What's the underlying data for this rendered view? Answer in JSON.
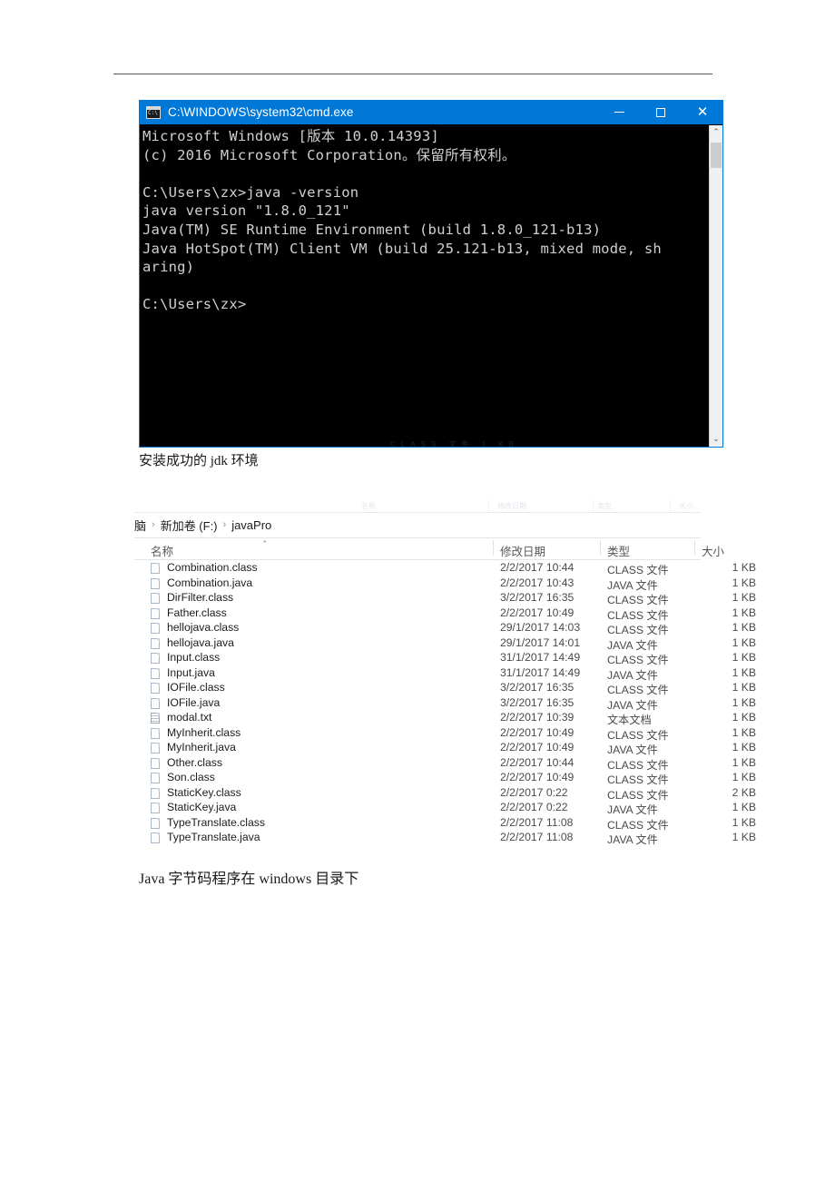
{
  "document": {
    "caption_1": "安装成功的 jdk 环境",
    "caption_2": "Java 字节码程序在 windows 目录下",
    "ghost_artifact": "CLASS 文件     1 KB"
  },
  "cmd_window": {
    "title": "C:\\WINDOWS\\system32\\cmd.exe",
    "icon": "cmd-icon",
    "buttons": {
      "minimize": "minimize",
      "maximize": "maximize",
      "close": "close"
    },
    "console_text": "Microsoft Windows [版本 10.0.14393]\n(c) 2016 Microsoft Corporation。保留所有权利。\n\nC:\\Users\\zx>java -version\njava version \"1.8.0_121\"\nJava(TM) SE Runtime Environment (build 1.8.0_121-b13)\nJava HotSpot(TM) Client VM (build 25.121-b13, mixed mode, sh\naring)\n\nC:\\Users\\zx>",
    "scrollbar": {
      "up_arrow": "⌃",
      "down_arrow": "⌄"
    },
    "colors": {
      "titlebar": "#0078d7",
      "background": "#000000",
      "text": "#cfd0d1"
    }
  },
  "explorer": {
    "breadcrumb": [
      "脑",
      "新加卷 (F:)",
      "javaPro"
    ],
    "breadcrumb_separator": "›",
    "ghost_headers": [
      "名称",
      "修改日期",
      "类型",
      "大小"
    ],
    "columns": [
      {
        "label": "名称",
        "sorted": "asc",
        "caret": "⌃"
      },
      {
        "label": "修改日期"
      },
      {
        "label": "类型"
      },
      {
        "label": "大小"
      }
    ],
    "files": [
      {
        "name": "Combination.class",
        "date": "2/2/2017 10:44",
        "type": "CLASS 文件",
        "size": "1 KB",
        "icon": "file-icon"
      },
      {
        "name": "Combination.java",
        "date": "2/2/2017 10:43",
        "type": "JAVA 文件",
        "size": "1 KB",
        "icon": "file-icon"
      },
      {
        "name": "DirFilter.class",
        "date": "3/2/2017 16:35",
        "type": "CLASS 文件",
        "size": "1 KB",
        "icon": "file-icon"
      },
      {
        "name": "Father.class",
        "date": "2/2/2017 10:49",
        "type": "CLASS 文件",
        "size": "1 KB",
        "icon": "file-icon"
      },
      {
        "name": "hellojava.class",
        "date": "29/1/2017 14:03",
        "type": "CLASS 文件",
        "size": "1 KB",
        "icon": "file-icon"
      },
      {
        "name": "hellojava.java",
        "date": "29/1/2017 14:01",
        "type": "JAVA 文件",
        "size": "1 KB",
        "icon": "file-icon"
      },
      {
        "name": "Input.class",
        "date": "31/1/2017 14:49",
        "type": "CLASS 文件",
        "size": "1 KB",
        "icon": "file-icon"
      },
      {
        "name": "Input.java",
        "date": "31/1/2017 14:49",
        "type": "JAVA 文件",
        "size": "1 KB",
        "icon": "file-icon"
      },
      {
        "name": "IOFile.class",
        "date": "3/2/2017 16:35",
        "type": "CLASS 文件",
        "size": "1 KB",
        "icon": "file-icon"
      },
      {
        "name": "IOFile.java",
        "date": "3/2/2017 16:35",
        "type": "JAVA 文件",
        "size": "1 KB",
        "icon": "file-icon"
      },
      {
        "name": "modal.txt",
        "date": "2/2/2017 10:39",
        "type": "文本文档",
        "size": "1 KB",
        "icon": "text-file-icon"
      },
      {
        "name": "MyInherit.class",
        "date": "2/2/2017 10:49",
        "type": "CLASS 文件",
        "size": "1 KB",
        "icon": "file-icon"
      },
      {
        "name": "MyInherit.java",
        "date": "2/2/2017 10:49",
        "type": "JAVA 文件",
        "size": "1 KB",
        "icon": "file-icon"
      },
      {
        "name": "Other.class",
        "date": "2/2/2017 10:44",
        "type": "CLASS 文件",
        "size": "1 KB",
        "icon": "file-icon"
      },
      {
        "name": "Son.class",
        "date": "2/2/2017 10:49",
        "type": "CLASS 文件",
        "size": "1 KB",
        "icon": "file-icon"
      },
      {
        "name": "StaticKey.class",
        "date": "2/2/2017 0:22",
        "type": "CLASS 文件",
        "size": "2 KB",
        "icon": "file-icon"
      },
      {
        "name": "StaticKey.java",
        "date": "2/2/2017 0:22",
        "type": "JAVA 文件",
        "size": "1 KB",
        "icon": "file-icon"
      },
      {
        "name": "TypeTranslate.class",
        "date": "2/2/2017 11:08",
        "type": "CLASS 文件",
        "size": "1 KB",
        "icon": "file-icon"
      },
      {
        "name": "TypeTranslate.java",
        "date": "2/2/2017 11:08",
        "type": "JAVA 文件",
        "size": "1 KB",
        "icon": "file-icon"
      }
    ]
  }
}
